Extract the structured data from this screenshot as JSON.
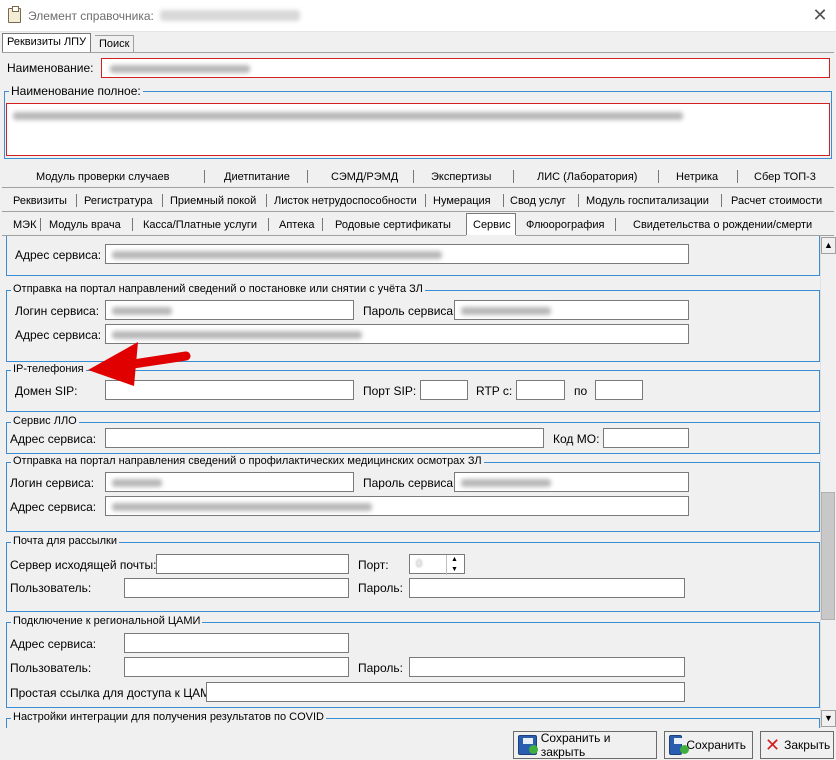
{
  "window": {
    "title": "Элемент справочника: ",
    "close_glyph": "✕"
  },
  "top_tabs": [
    "Реквизиты ЛПУ",
    "Поиск"
  ],
  "naimenovanie_label": "Наименование:",
  "naimenovanie_full_label": "Наименование полное:",
  "tabs_row1": [
    "Модуль проверки случаев",
    "Диетпитание",
    "СЭМД/РЭМД",
    "Экспертизы",
    "ЛИС (Лаборатория)",
    "Нетрика",
    "Сбер ТОП-3"
  ],
  "tabs_row2": [
    "Реквизиты",
    "Регистратура",
    "Приемный покой",
    "Листок нетрудоспособности",
    "Нумерация",
    "Свод услуг",
    "Модуль госпитализации",
    "Расчет стоимости"
  ],
  "tabs_row3": [
    "МЭК",
    "Модуль врача",
    "Касса/Платные услуги",
    "Аптека",
    "Родовые сертификаты",
    "Сервис",
    "Флюорография",
    "Свидетельства о рождении/смерти"
  ],
  "active_tab": "Сервис",
  "sections": {
    "top_partial": {
      "address_label": "Адрес сервиса:"
    },
    "portal_zl": {
      "legend": "Отправка на портал направлений сведений о постановке или снятии с учёта ЗЛ",
      "login_label": "Логин сервиса:",
      "password_label": "Пароль сервиса:",
      "address_label": "Адрес сервиса:"
    },
    "ip_telephony": {
      "legend": "IP-телефония",
      "domain_label": "Домен SIP:",
      "port_label": "Порт SIP:",
      "rtp_label": "RTP с:",
      "to_label": "по"
    },
    "llo": {
      "legend": "Сервис ЛЛО",
      "address_label": "Адрес сервиса:",
      "mo_code_label": "Код МО:"
    },
    "profilaktika": {
      "legend": "Отправка на портал направления сведений о профилактических медицинских осмотрах ЗЛ",
      "login_label": "Логин сервиса:",
      "password_label": "Пароль сервиса:",
      "address_label": "Адрес сервиса:"
    },
    "mail": {
      "legend": "Почта для рассылки",
      "smtp_label": "Сервер исходящей почты:",
      "port_label": "Порт:",
      "user_label": "Пользователь:",
      "password_label": "Пароль:",
      "port_value": "0"
    },
    "cami": {
      "legend": "Подключение к региональной ЦАМИ",
      "address_label": "Адрес сервиса:",
      "user_label": "Пользователь:",
      "password_label": "Пароль:",
      "link_label": "Простая ссылка для доступа к ЦАМИ:"
    },
    "covid": {
      "legend": "Настройки интеграции для получения результатов по COVID"
    }
  },
  "buttons": {
    "save_close": "Сохранить и закрыть",
    "save": "Сохранить",
    "close": "Закрыть"
  },
  "scroll": {
    "up_glyph": "▲",
    "down_glyph": "▼"
  },
  "spinner": {
    "up_glyph": "▲",
    "down_glyph": "▼"
  },
  "colors": {
    "accent_border": "#3c8cd4",
    "error_border": "#d21f1f",
    "arrow": "#e00000"
  }
}
